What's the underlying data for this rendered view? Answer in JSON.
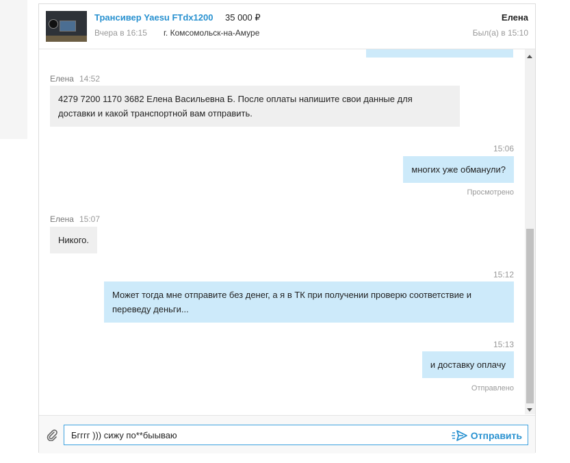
{
  "listing": {
    "title": "Трансивер Yaesu FTdx1200",
    "price": "35 000 ₽",
    "date": "Вчера в 16:15",
    "city": "г. Комсомольск-на-Амуре"
  },
  "contact": {
    "name": "Елена",
    "last_seen": "Был(а) в 15:10"
  },
  "messages": [
    {
      "author": "Елена",
      "time": "14:52",
      "text": "4279 7200 1170 3682 Елена Васильевна Б. После оплаты напишите свои данные для доставки и какой транспортной вам отправить."
    },
    {
      "time": "15:06",
      "text": "многих уже обманули?",
      "status": "Просмотрено"
    },
    {
      "author": "Елена",
      "time": "15:07",
      "text": "Никого."
    },
    {
      "time": "15:12",
      "text": "Может тогда мне отправите без денег, а я в ТК при получении проверю соответствие и переведу деньги..."
    },
    {
      "time": "15:13",
      "text": "и доставку оплачу",
      "status": "Отправлено"
    }
  ],
  "composer": {
    "draft": "Бгггг ))) сижу по**быываю",
    "send_label": "Отправить"
  },
  "colors": {
    "accent": "#2891d0",
    "outgoing": "#cdeafa",
    "incoming": "#efefef"
  },
  "icons": [
    "paperclip-icon",
    "send-icon",
    "scroll-up-icon",
    "scroll-down-icon"
  ]
}
